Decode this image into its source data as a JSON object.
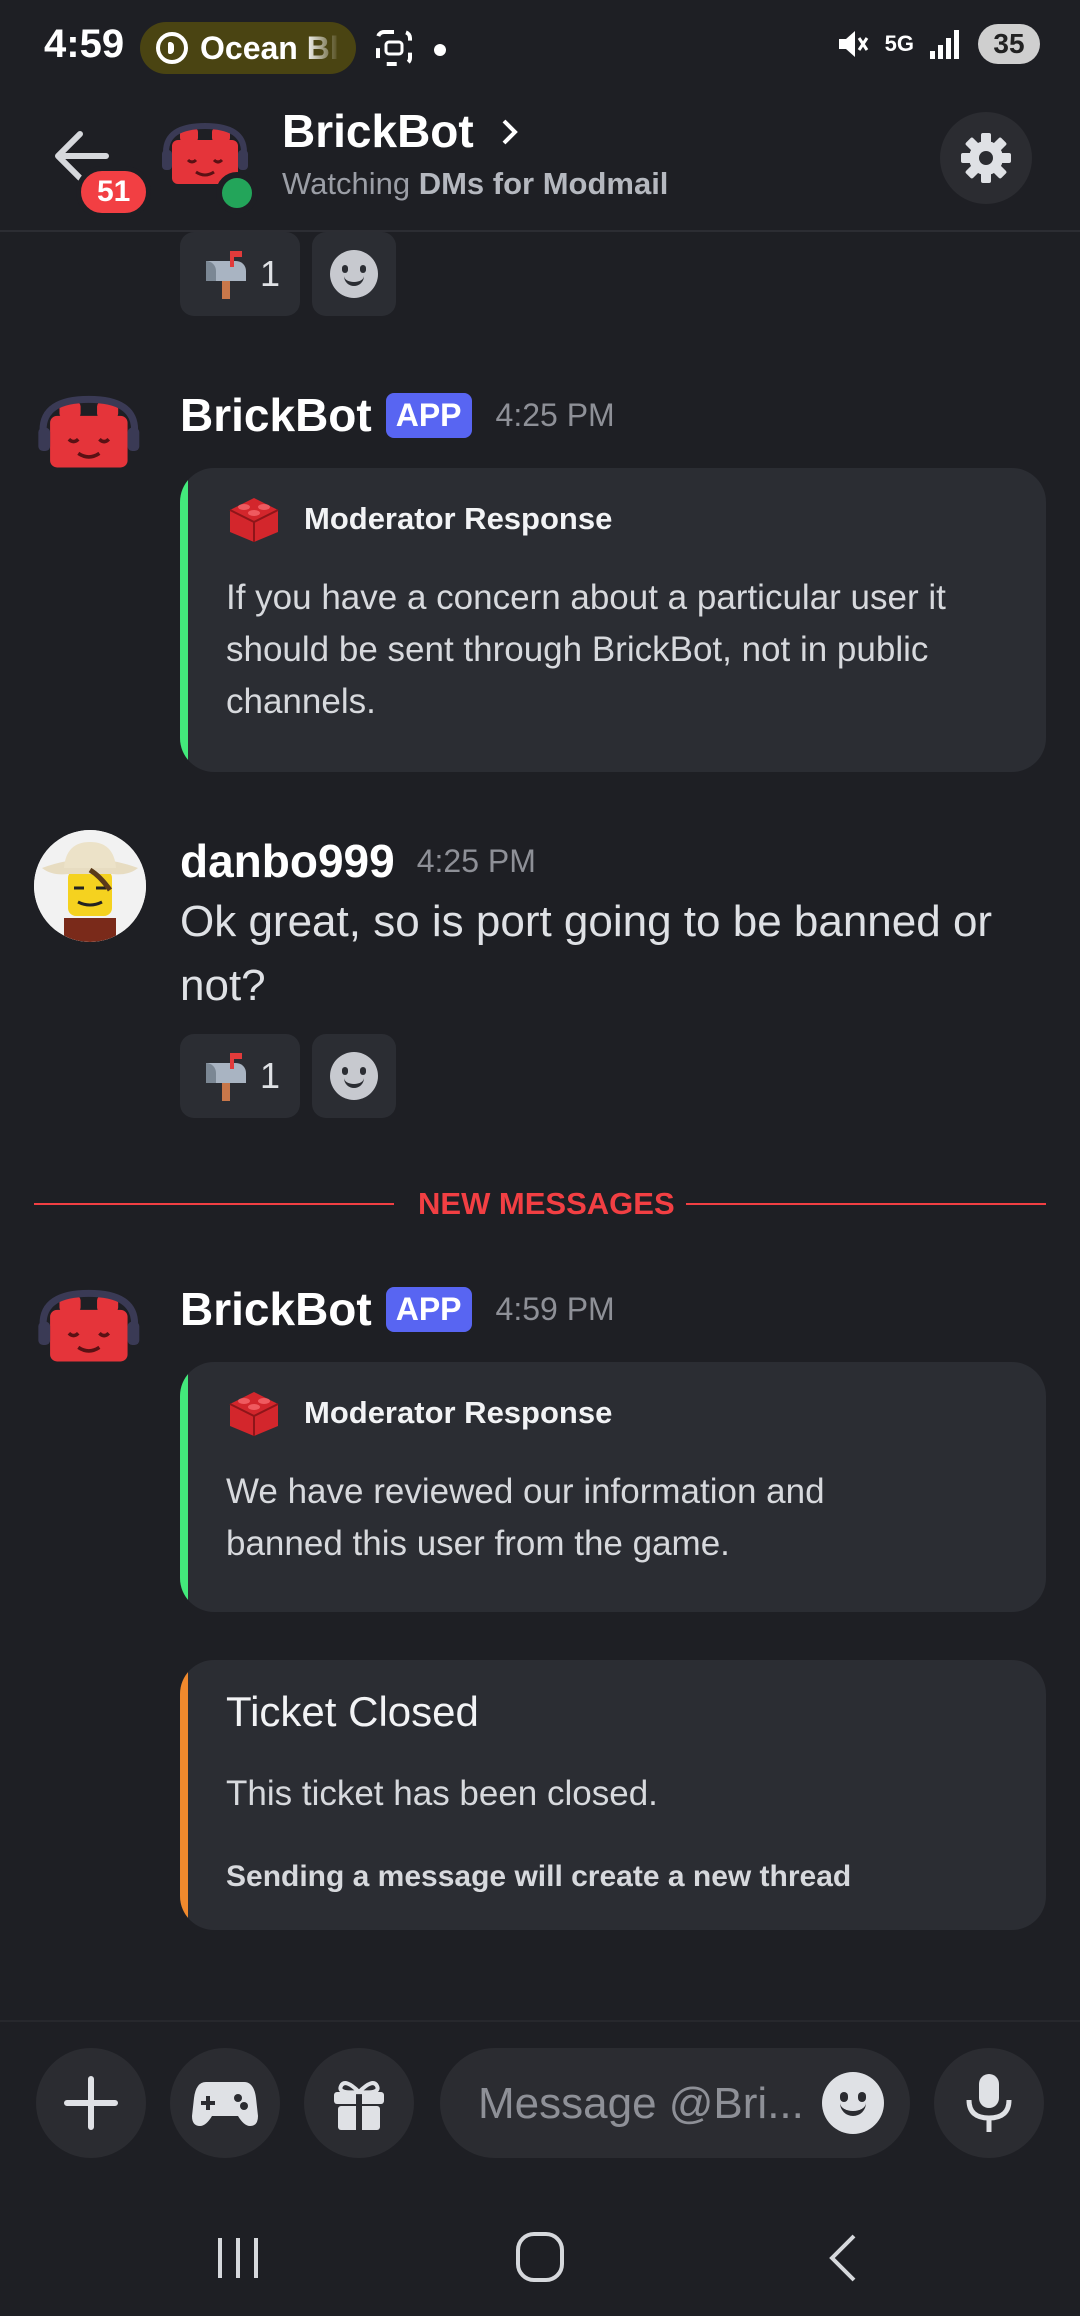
{
  "status_bar": {
    "time": "4:59",
    "media_pill": "Ocean Bl",
    "network": "5G",
    "battery": "35"
  },
  "header": {
    "back_badge": "51",
    "title": "BrickBot",
    "subtitle_prefix": "Watching ",
    "subtitle_bold": "DMs for Modmail"
  },
  "messages": [
    {
      "author": "BrickBot",
      "tag": "APP",
      "time": "4:25 PM",
      "embed_author": "Moderator Response",
      "embed_text": "If you have a concern about a particular user it should be sent through BrickBot, not in public channels."
    },
    {
      "author": "danbo999",
      "time": "4:25 PM",
      "text": "Ok great, so is port going to be banned or not?",
      "reaction_count": "1"
    },
    {
      "author": "BrickBot",
      "tag": "APP",
      "time": "4:59 PM",
      "embed_author": "Moderator Response",
      "embed_text": "We have reviewed our information and banned this user from the game.",
      "ticket_title": "Ticket Closed",
      "ticket_text": "This ticket has been closed.",
      "ticket_footer": "Sending a message will create a new thread"
    }
  ],
  "top_reaction_count": "1",
  "divider_label": "NEW MESSAGES",
  "composer": {
    "placeholder": "Message @Bri..."
  },
  "colors": {
    "accent_blurple": "#5865f2",
    "embed_green": "#43e97b",
    "embed_orange": "#f0892d",
    "new_messages_red": "#f23f43"
  }
}
